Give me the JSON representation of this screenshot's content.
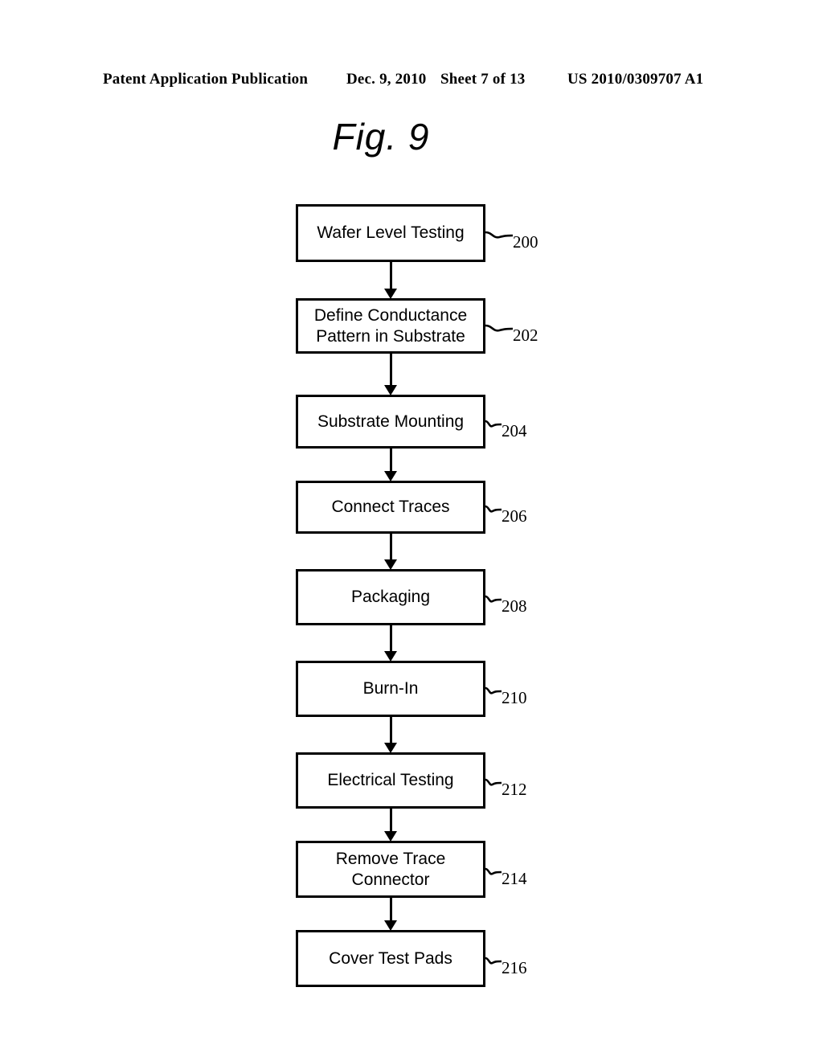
{
  "header": {
    "publication": "Patent Application Publication",
    "date": "Dec. 9, 2010",
    "sheet": "Sheet 7 of 13",
    "doc_number": "US 2010/0309707 A1"
  },
  "figure": {
    "title": "Fig. 9"
  },
  "chart_data": {
    "type": "diagram",
    "diagram_kind": "flowchart",
    "title": "Fig. 9",
    "orientation": "vertical",
    "node_shape": "rectangle",
    "connector_style": "solid-line-with-filled-arrowhead",
    "nodes": [
      {
        "id": "200",
        "label": "Wafer Level Testing",
        "ref": "200"
      },
      {
        "id": "202",
        "label": "Define Conductance\nPattern in Substrate",
        "ref": "202"
      },
      {
        "id": "204",
        "label": "Substrate Mounting",
        "ref": "204"
      },
      {
        "id": "206",
        "label": "Connect Traces",
        "ref": "206"
      },
      {
        "id": "208",
        "label": "Packaging",
        "ref": "208"
      },
      {
        "id": "210",
        "label": "Burn-In",
        "ref": "210"
      },
      {
        "id": "212",
        "label": "Electrical Testing",
        "ref": "212"
      },
      {
        "id": "214",
        "label": "Remove Trace\nConnector",
        "ref": "214"
      },
      {
        "id": "216",
        "label": "Cover Test Pads",
        "ref": "216"
      }
    ],
    "edges": [
      {
        "from": "200",
        "to": "202"
      },
      {
        "from": "202",
        "to": "204"
      },
      {
        "from": "204",
        "to": "206"
      },
      {
        "from": "206",
        "to": "208"
      },
      {
        "from": "208",
        "to": "210"
      },
      {
        "from": "210",
        "to": "212"
      },
      {
        "from": "212",
        "to": "214"
      },
      {
        "from": "214",
        "to": "216"
      }
    ],
    "colors": {
      "stroke": "#000000",
      "fill": "#ffffff",
      "text": "#000000"
    }
  }
}
